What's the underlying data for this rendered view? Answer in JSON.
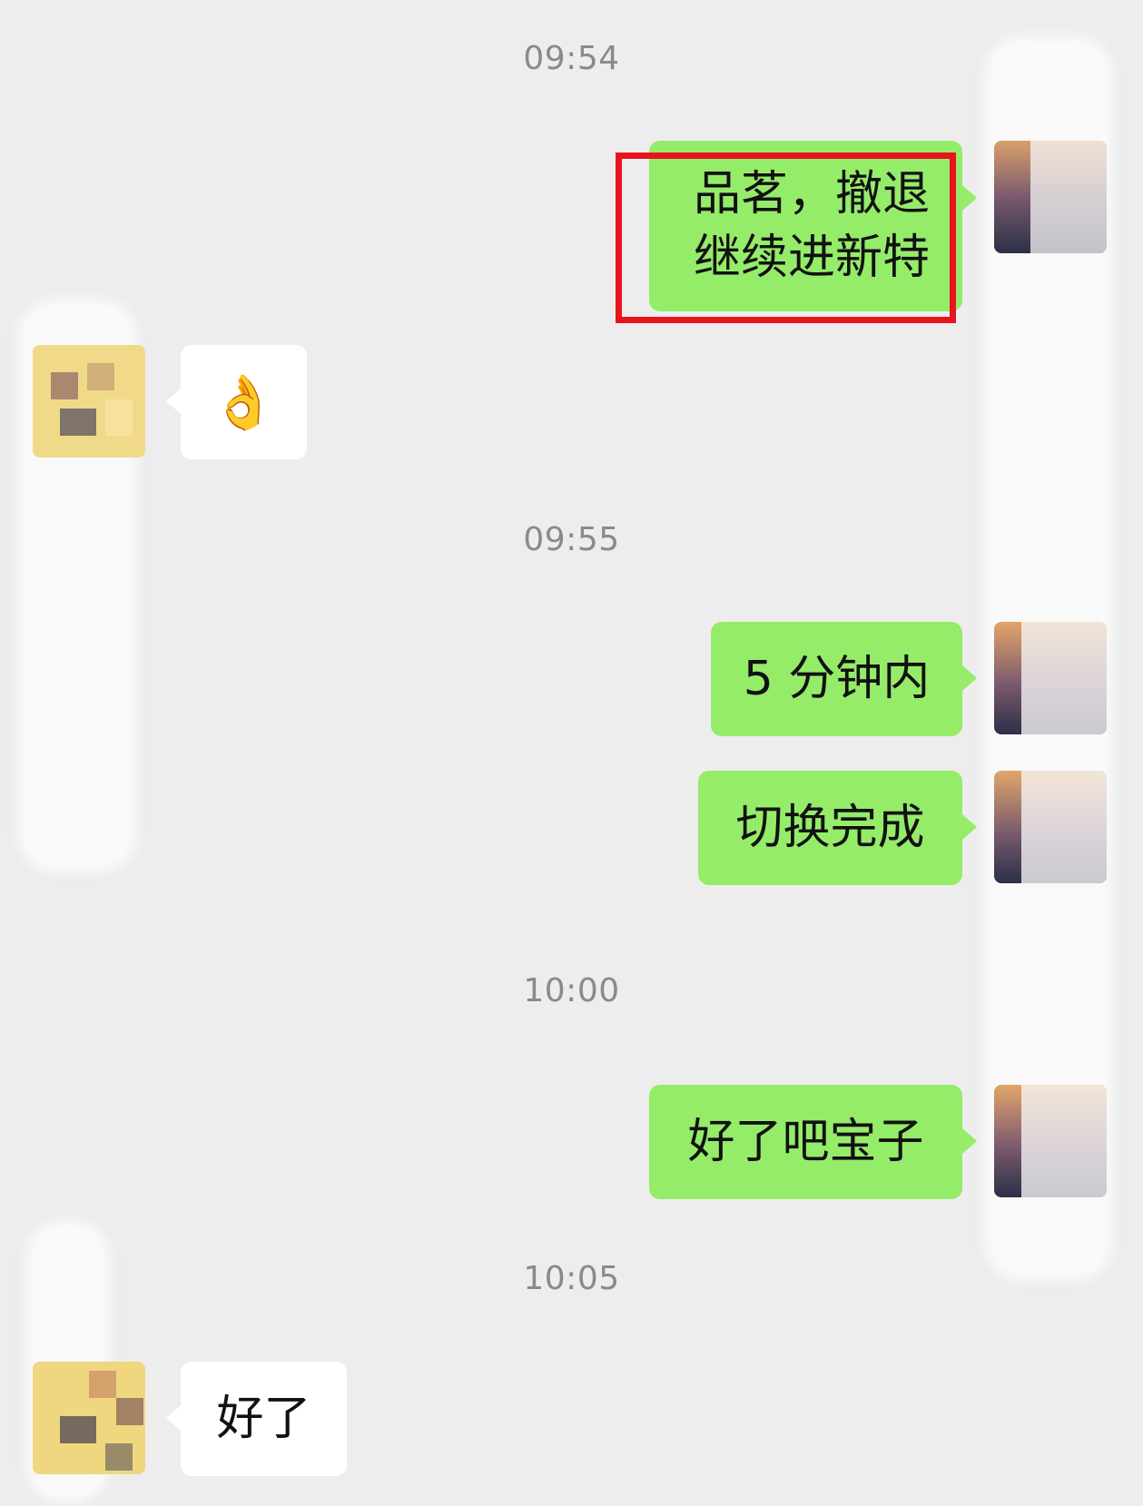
{
  "chat": {
    "timestamps": [
      "09:54",
      "09:55",
      "10:00",
      "10:05"
    ],
    "messages": [
      {
        "id": "m1",
        "side": "out",
        "lines": [
          "品茗，撤退",
          "继续进新特"
        ],
        "highlighted": true
      },
      {
        "id": "m2",
        "side": "in",
        "text": "👌",
        "emoji": "ok-hand"
      },
      {
        "id": "m3",
        "side": "out",
        "text": "5 分钟内"
      },
      {
        "id": "m4",
        "side": "out",
        "text": "切换完成"
      },
      {
        "id": "m5",
        "side": "out",
        "text": "好了吧宝子"
      },
      {
        "id": "m6",
        "side": "in",
        "text": "好了"
      }
    ]
  },
  "colors": {
    "background": "#ededed",
    "outgoing_bubble": "#95ec69",
    "incoming_bubble": "#ffffff",
    "timestamp": "#8a8a8a",
    "highlight_box": "#e8141b"
  }
}
